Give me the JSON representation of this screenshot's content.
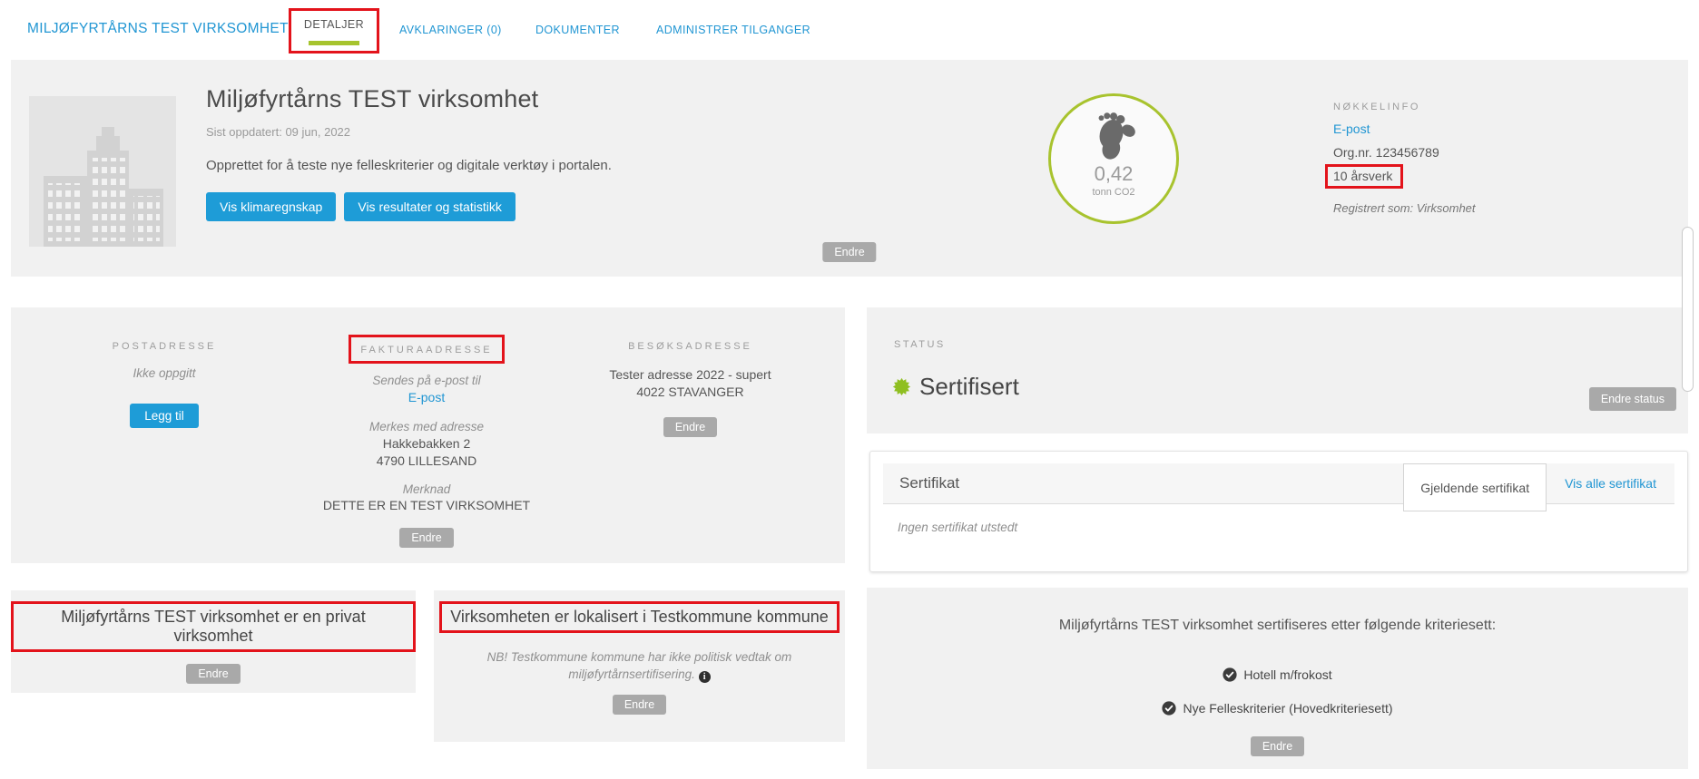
{
  "nav": {
    "brand": "MILJØFYRTÅRNS TEST VIRKSOMHET",
    "tabs": [
      {
        "label": "DETALJER",
        "active": true
      },
      {
        "label": "AVKLARINGER (0)",
        "active": false
      },
      {
        "label": "DOKUMENTER",
        "active": false
      },
      {
        "label": "ADMINISTRER TILGANGER",
        "active": false
      }
    ]
  },
  "header": {
    "title": "Miljøfyrtårns TEST virksomhet",
    "last_updated": "Sist oppdatert: 09 jun, 2022",
    "description": "Opprettet for å teste nye felleskriterier og digitale verktøy i portalen.",
    "buttons": {
      "climate": "Vis klimaregnskap",
      "results": "Vis resultater og statistikk"
    },
    "footprint": {
      "value": "0,42",
      "unit": "tonn CO2"
    },
    "keyinfo": {
      "label": "NØKKELINFO",
      "email_link": "E-post",
      "org_nr": "Org.nr. 123456789",
      "man_years": "10 årsverk",
      "registered_as": "Registrert som: Virksomhet"
    },
    "edit_label": "Endre"
  },
  "addresses": {
    "postal": {
      "label": "POSTADRESSE",
      "empty": "Ikke oppgitt",
      "add_label": "Legg til"
    },
    "invoice": {
      "label": "FAKTURAADRESSE",
      "sent_via": "Sendes på e-post til",
      "email_link": "E-post",
      "marked_with": "Merkes med adresse",
      "street": "Hakkebakken 2",
      "postal_code": "4790 LILLESAND",
      "note_label": "Merknad",
      "note": "DETTE ER EN TEST VIRKSOMHET",
      "edit_label": "Endre"
    },
    "visiting": {
      "label": "BESØKSADRESSE",
      "street": "Tester adresse 2022 - supert",
      "postal_code": "4022 STAVANGER",
      "edit_label": "Endre"
    }
  },
  "status": {
    "label": "STATUS",
    "value": "Sertifisert",
    "edit_label": "Endre status"
  },
  "certificate": {
    "title": "Sertifikat",
    "tabs": [
      "Gjeldende sertifikat",
      "Vis alle sertifikat"
    ],
    "empty": "Ingen sertifikat utstedt"
  },
  "ownership": {
    "text": "Miljøfyrtårns TEST virksomhet er en privat virksomhet",
    "edit_label": "Endre"
  },
  "municipality": {
    "text": "Virksomheten er lokalisert i Testkommune kommune",
    "note": "NB! Testkommune kommune har ikke politisk vedtak om miljøfyrtårnsertifisering.",
    "info_icon": "i",
    "edit_label": "Endre"
  },
  "criteria": {
    "heading": "Miljøfyrtårns TEST virksomhet sertifiseres etter følgende kriteriesett:",
    "items": [
      "Hotell m/frokost",
      "Nye Felleskriterier (Hovedkriteriesett)"
    ],
    "edit_label": "Endre"
  },
  "colors": {
    "accent_blue": "#1e9cd7",
    "link_blue": "#2196d3",
    "accent_green": "#a6c42e",
    "status_green": "#8fbf21",
    "annotation_red": "#e3131b",
    "card_gray": "#f1f1f1"
  }
}
